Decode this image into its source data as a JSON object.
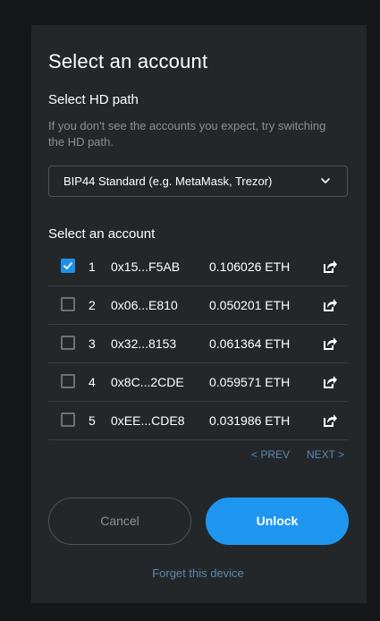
{
  "dialog": {
    "title": "Select an account"
  },
  "hd_path": {
    "heading": "Select HD path",
    "help_text": "If you don't see the accounts you expect, try switching the HD path.",
    "selected": "BIP44 Standard (e.g. MetaMask, Trezor)"
  },
  "accounts": {
    "heading": "Select an account",
    "rows": [
      {
        "index": "1",
        "address": "0x15...F5AB",
        "balance": "0.106026 ETH",
        "checked": true
      },
      {
        "index": "2",
        "address": "0x06...E810",
        "balance": "0.050201 ETH",
        "checked": false
      },
      {
        "index": "3",
        "address": "0x32...8153",
        "balance": "0.061364 ETH",
        "checked": false
      },
      {
        "index": "4",
        "address": "0x8C...2CDE",
        "balance": "0.059571 ETH",
        "checked": false
      },
      {
        "index": "5",
        "address": "0xEE...CDE8",
        "balance": "0.031986 ETH",
        "checked": false
      }
    ]
  },
  "pagination": {
    "prev_label": "< PREV",
    "next_label": "NEXT >"
  },
  "actions": {
    "cancel_label": "Cancel",
    "unlock_label": "Unlock",
    "forget_label": "Forget this device"
  },
  "colors": {
    "background": "#151719",
    "panel": "#24272a",
    "accent": "#1e96f0",
    "link": "#5b87ad",
    "muted_text": "#8a9097"
  },
  "icons": {
    "select_arrow": "chevron-down-icon",
    "row_action": "external-link-icon",
    "checked_mark": "check-icon"
  }
}
